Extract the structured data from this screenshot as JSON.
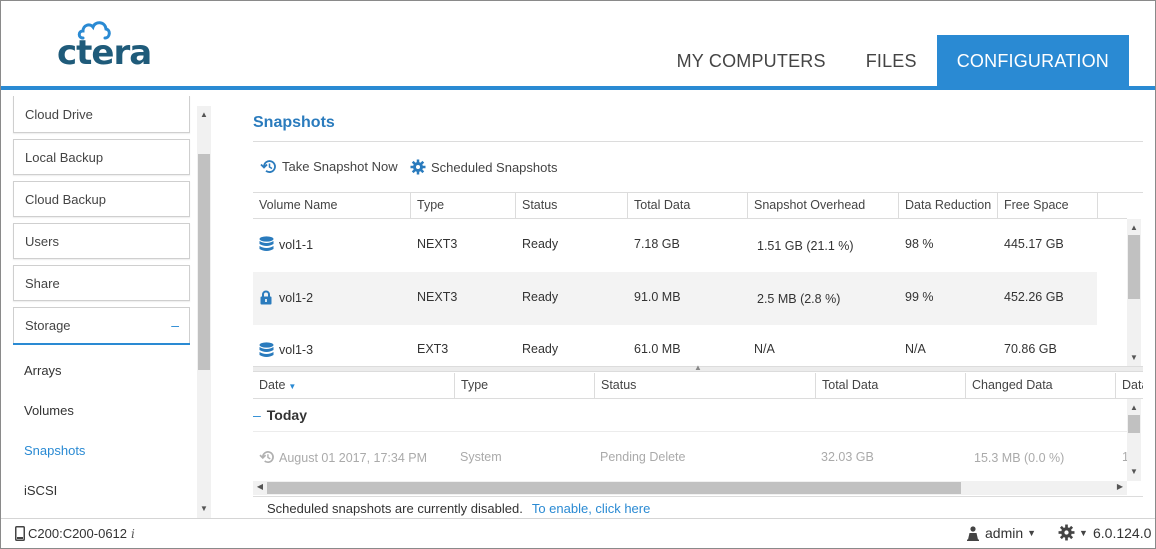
{
  "brand": {
    "logo_text": "ctera",
    "color": "#1f5b7a",
    "accent": "#2a8ad3"
  },
  "nav": {
    "tabs": [
      {
        "label": "MY COMPUTERS",
        "active": false
      },
      {
        "label": "FILES",
        "active": false
      },
      {
        "label": "CONFIGURATION",
        "active": true
      }
    ]
  },
  "sidebar": {
    "items": [
      {
        "label": "Cloud Drive"
      },
      {
        "label": "Local Backup"
      },
      {
        "label": "Cloud Backup"
      },
      {
        "label": "Users"
      },
      {
        "label": "Share"
      },
      {
        "label": "Storage",
        "expanded": true,
        "toggle": "–"
      }
    ],
    "subitems": [
      {
        "label": "Arrays",
        "active": false
      },
      {
        "label": "Volumes",
        "active": false
      },
      {
        "label": "Snapshots",
        "active": true
      },
      {
        "label": "iSCSI",
        "active": false
      }
    ]
  },
  "main": {
    "title": "Snapshots",
    "toolbar": {
      "take_snapshot": "Take Snapshot Now",
      "scheduled": "Scheduled Snapshots"
    },
    "volumes_grid": {
      "columns": [
        "Volume Name",
        "Type",
        "Status",
        "Total Data",
        "Snapshot Overhead",
        "Data Reduction",
        "Free Space"
      ],
      "rows": [
        {
          "icon": "database-icon",
          "name": "vol1-1",
          "type": "NEXT3",
          "status": "Ready",
          "total": "7.18 GB",
          "overhead": "1.51 GB (21.1 %)",
          "reduction": "98 %",
          "free": "445.17 GB"
        },
        {
          "icon": "lock-icon",
          "name": "vol1-2",
          "type": "NEXT3",
          "status": "Ready",
          "total": "91.0 MB",
          "overhead": "2.5 MB (2.8 %)",
          "reduction": "99 %",
          "free": "452.26 GB"
        },
        {
          "icon": "database-icon",
          "name": "vol1-3",
          "type": "EXT3",
          "status": "Ready",
          "total": "61.0 MB",
          "overhead": "N/A",
          "reduction": "N/A",
          "free": "70.86 GB"
        }
      ]
    },
    "snapshots_grid": {
      "columns": [
        "Date",
        "Type",
        "Status",
        "Total Data",
        "Changed Data",
        "Data"
      ],
      "sort_column": "Date",
      "group": {
        "toggle": "–",
        "label": "Today"
      },
      "rows": [
        {
          "date": "August 01 2017, 17:34 PM",
          "type": "System",
          "status": "Pending Delete",
          "total": "32.03 GB",
          "changed": "15.3 MB (0.0 %)",
          "extra": "1"
        }
      ]
    },
    "notice": {
      "text": "Scheduled snapshots are currently disabled.",
      "link": "To enable, click here"
    }
  },
  "statusbar": {
    "device": "C200:C200-0612",
    "info_glyph": "i",
    "user": "admin",
    "version": "6.0.124.0"
  }
}
